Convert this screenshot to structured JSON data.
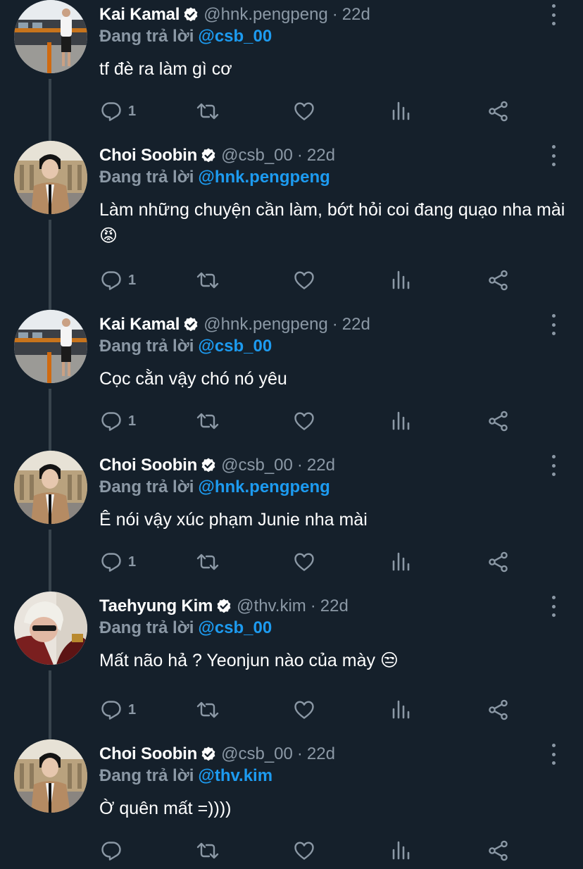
{
  "reply_prefix": "Đang trả lời",
  "colors": {
    "background": "#15202b",
    "secondary_text": "#8b98a5",
    "mention": "#1d9bf0",
    "verified_badge": "#ffffff",
    "thread_line": "#38444d"
  },
  "tweets": [
    {
      "name": "Kai Kamal",
      "handle": "@hnk.pengpeng",
      "separator": "·",
      "time": "22d",
      "reply_to": "@csb_00",
      "text": "tf đè ra làm gì cơ",
      "reply_count": "1",
      "avatar_icon": "avatar-kai-kamal"
    },
    {
      "name": "Choi Soobin",
      "handle": "@csb_00",
      "separator": "·",
      "time": "22d",
      "reply_to": "@hnk.pengpeng",
      "text": "Làm những chuyện cần làm, bớt hỏi coi đang quạo nha mài 😡",
      "reply_count": "1",
      "avatar_icon": "avatar-choi-soobin"
    },
    {
      "name": "Kai Kamal",
      "handle": "@hnk.pengpeng",
      "separator": "·",
      "time": "22d",
      "reply_to": "@csb_00",
      "text": "Cọc cằn vậy chó nó yêu",
      "reply_count": "1",
      "avatar_icon": "avatar-kai-kamal"
    },
    {
      "name": "Choi Soobin",
      "handle": "@csb_00",
      "separator": "·",
      "time": "22d",
      "reply_to": "@hnk.pengpeng",
      "text": "Ê nói vậy xúc phạm Junie nha mài",
      "reply_count": "1",
      "avatar_icon": "avatar-choi-soobin"
    },
    {
      "name": "Taehyung Kim",
      "handle": "@thv.kim",
      "separator": "·",
      "time": "22d",
      "reply_to": "@csb_00",
      "text": "Mất não hả ? Yeonjun nào của mày 😒",
      "reply_count": "1",
      "avatar_icon": "avatar-taehyung-kim"
    },
    {
      "name": "Choi Soobin",
      "handle": "@csb_00",
      "separator": "·",
      "time": "22d",
      "reply_to": "@thv.kim",
      "text": "Ờ quên mất =))))",
      "reply_count": "",
      "avatar_icon": "avatar-choi-soobin"
    }
  ]
}
